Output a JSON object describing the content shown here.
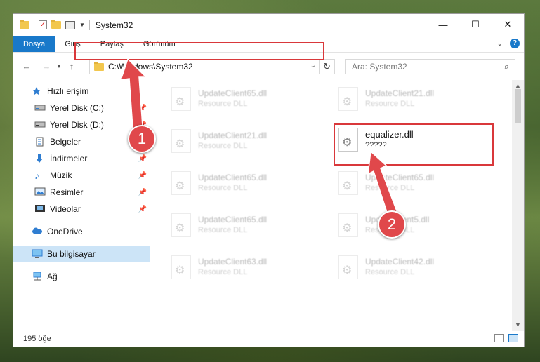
{
  "window": {
    "title": "System32",
    "controls": {
      "minimize": "—",
      "maximize": "☐",
      "close": "✕"
    }
  },
  "ribbon": {
    "tabs": [
      "Dosya",
      "Giriş",
      "Paylaş",
      "Görünüm"
    ],
    "active_tab": "Dosya"
  },
  "navigation": {
    "address": "C:\\Windows\\System32",
    "search_placeholder": "Ara: System32"
  },
  "sidebar": {
    "items": [
      {
        "label": "Hızlı erişim",
        "icon": "star-icon",
        "pinned": false
      },
      {
        "label": "Yerel Disk (C:)",
        "icon": "drive-icon",
        "pinned": true
      },
      {
        "label": "Yerel Disk (D:)",
        "icon": "drive-icon",
        "pinned": true
      },
      {
        "label": "Belgeler",
        "icon": "documents-icon",
        "pinned": true
      },
      {
        "label": "İndirmeler",
        "icon": "download-icon",
        "pinned": true
      },
      {
        "label": "Müzik",
        "icon": "music-icon",
        "pinned": true
      },
      {
        "label": "Resimler",
        "icon": "pictures-icon",
        "pinned": true
      },
      {
        "label": "Videolar",
        "icon": "videos-icon",
        "pinned": true
      },
      {
        "label": "OneDrive",
        "icon": "cloud-icon",
        "pinned": false
      },
      {
        "label": "Bu bilgisayar",
        "icon": "computer-icon",
        "pinned": false
      },
      {
        "label": "Ağ",
        "icon": "network-icon",
        "pinned": false
      }
    ]
  },
  "files": [
    {
      "name": "UpdateClient65.dll",
      "type": "Resource DLL"
    },
    {
      "name": "UpdateClient21.dll",
      "type": "Resource DLL"
    },
    {
      "name": "UpdateClient21.dll",
      "type": "Resource DLL"
    },
    {
      "name": "equalizer.dll",
      "type": "?????"
    },
    {
      "name": "UpdateClient65.dll",
      "type": "Resource DLL"
    },
    {
      "name": "UpdateClient65.dll",
      "type": "Resource DLL"
    },
    {
      "name": "UpdateClient65.dll",
      "type": "Resource DLL"
    },
    {
      "name": "UpdateClient5.dll",
      "type": "Resource DLL"
    },
    {
      "name": "UpdateClient63.dll",
      "type": "Resource DLL"
    },
    {
      "name": "UpdateClient42.dll",
      "type": "Resource DLL"
    }
  ],
  "status": {
    "count": "195 öğe"
  },
  "annotations": {
    "step1": "1",
    "step2": "2"
  },
  "colors": {
    "accent": "#1979ca",
    "highlight": "#d9383b",
    "selected": "#cce4f7"
  }
}
